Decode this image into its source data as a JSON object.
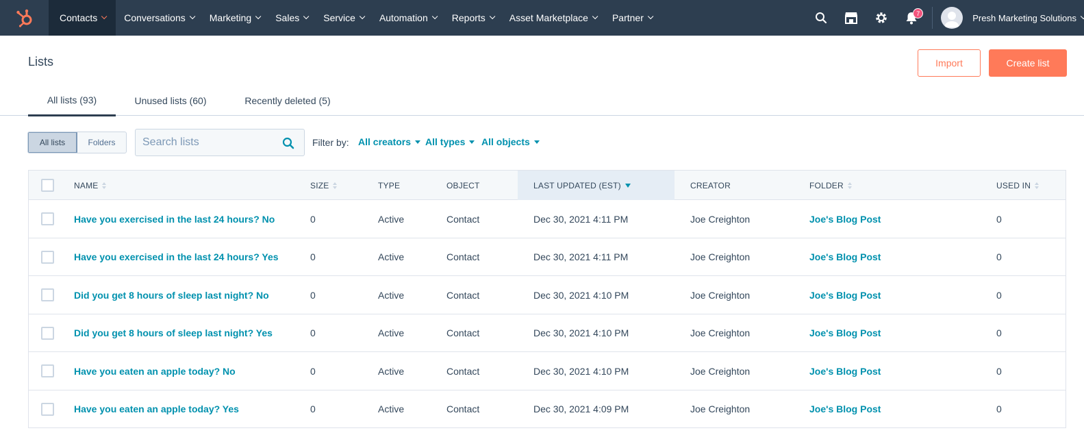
{
  "nav": {
    "items": [
      {
        "label": "Contacts",
        "active": true
      },
      {
        "label": "Conversations"
      },
      {
        "label": "Marketing"
      },
      {
        "label": "Sales"
      },
      {
        "label": "Service"
      },
      {
        "label": "Automation"
      },
      {
        "label": "Reports"
      },
      {
        "label": "Asset Marketplace"
      },
      {
        "label": "Partner"
      }
    ],
    "notifications_count": "7",
    "account_name": "Presh Marketing Solutions",
    "icons": [
      "hubspot-logo-icon",
      "search-icon",
      "marketplace-icon",
      "settings-gear-icon",
      "notification-bell-icon",
      "user-avatar-icon"
    ]
  },
  "header": {
    "title": "Lists",
    "import_label": "Import",
    "create_label": "Create list"
  },
  "tabs": [
    {
      "label": "All lists (93)",
      "active": true
    },
    {
      "label": "Unused lists (60)"
    },
    {
      "label": "Recently deleted (5)"
    }
  ],
  "controls": {
    "view_toggle": [
      {
        "label": "All lists",
        "selected": true
      },
      {
        "label": "Folders"
      }
    ],
    "search_placeholder": "Search lists",
    "filter_label": "Filter by:",
    "filters": [
      "All creators",
      "All types",
      "All objects"
    ]
  },
  "table": {
    "columns": [
      "NAME",
      "SIZE",
      "TYPE",
      "OBJECT",
      "LAST UPDATED (EST)",
      "CREATOR",
      "FOLDER",
      "USED IN"
    ],
    "sorted_column": "LAST UPDATED (EST)",
    "rows": [
      {
        "name": "Have you exercised in the last 24 hours? No",
        "size": "0",
        "type": "Active",
        "object": "Contact",
        "updated": "Dec 30, 2021 4:11 PM",
        "creator": "Joe Creighton",
        "folder": "Joe's Blog Post",
        "used_in": "0"
      },
      {
        "name": "Have you exercised in the last 24 hours? Yes",
        "size": "0",
        "type": "Active",
        "object": "Contact",
        "updated": "Dec 30, 2021 4:11 PM",
        "creator": "Joe Creighton",
        "folder": "Joe's Blog Post",
        "used_in": "0"
      },
      {
        "name": "Did you get 8 hours of sleep last night? No",
        "size": "0",
        "type": "Active",
        "object": "Contact",
        "updated": "Dec 30, 2021 4:10 PM",
        "creator": "Joe Creighton",
        "folder": "Joe's Blog Post",
        "used_in": "0"
      },
      {
        "name": "Did you get 8 hours of sleep last night? Yes",
        "size": "0",
        "type": "Active",
        "object": "Contact",
        "updated": "Dec 30, 2021 4:10 PM",
        "creator": "Joe Creighton",
        "folder": "Joe's Blog Post",
        "used_in": "0"
      },
      {
        "name": "Have you eaten an apple today? No",
        "size": "0",
        "type": "Active",
        "object": "Contact",
        "updated": "Dec 30, 2021 4:10 PM",
        "creator": "Joe Creighton",
        "folder": "Joe's Blog Post",
        "used_in": "0"
      },
      {
        "name": "Have you eaten an apple today? Yes",
        "size": "0",
        "type": "Active",
        "object": "Contact",
        "updated": "Dec 30, 2021 4:09 PM",
        "creator": "Joe Creighton",
        "folder": "Joe's Blog Post",
        "used_in": "0"
      }
    ]
  },
  "colors": {
    "nav_bg": "#2d3e50",
    "accent_orange": "#ff7a59",
    "link_teal": "#0091ae",
    "text": "#33475b"
  }
}
